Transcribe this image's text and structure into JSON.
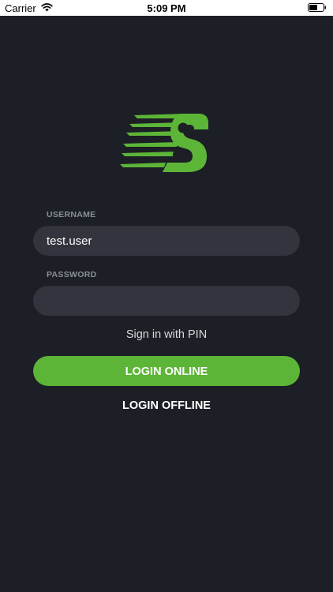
{
  "status_bar": {
    "carrier": "Carrier",
    "time": "5:09 PM",
    "wifi_icon": "wifi-icon",
    "battery_icon": "battery-icon"
  },
  "app": {
    "logo_icon": "swoosh-s-logo",
    "brand_color": "#5db538"
  },
  "login_form": {
    "username_label": "USERNAME",
    "username_value": "test.user",
    "password_label": "PASSWORD",
    "password_value": "",
    "pin_link": "Sign in with PIN",
    "login_online_label": "LOGIN ONLINE",
    "login_offline_label": "LOGIN OFFLINE"
  }
}
